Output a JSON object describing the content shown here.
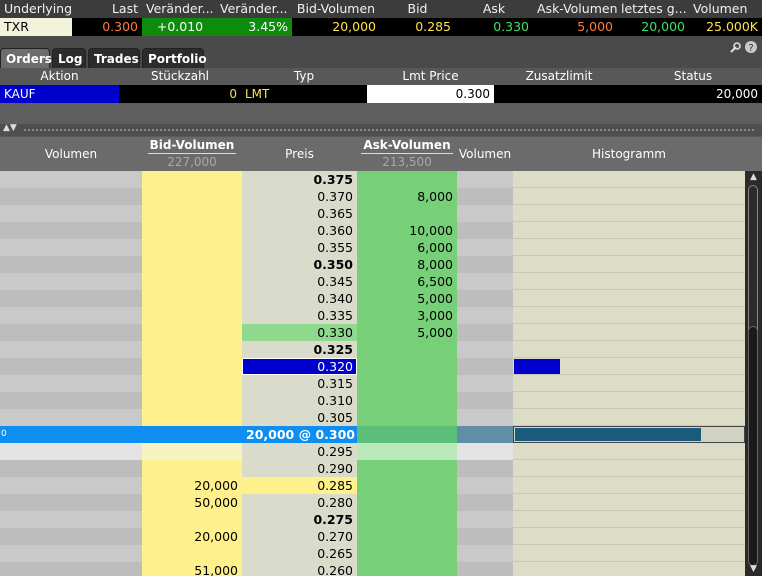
{
  "quote": {
    "headers": [
      "Underlying",
      "Last",
      "Veränder...",
      "Veränder...",
      "Bid-Volumen",
      "Bid",
      "Ask",
      "Ask-Volumen",
      "letztes g...",
      "Volumen"
    ],
    "symbol": "TXR",
    "last": "0.300",
    "change": "+0.010",
    "change_pct": "3.45%",
    "bid_volume": "20,000",
    "bid": "0.285",
    "ask": "0.330",
    "ask_volume": "5,000",
    "last_size": "20,000",
    "volume": "25.000K"
  },
  "tabs": [
    "Orders",
    "Log",
    "Trades",
    "Portfolio"
  ],
  "orders": {
    "headers": [
      "Aktion",
      "Stückzahl",
      "Typ",
      "Lmt Price",
      "Zusatzlimit",
      "Status"
    ],
    "row": {
      "action": "KAUF",
      "qty": "0",
      "type": "LMT",
      "lmt_price": "0.300",
      "zusatz": "",
      "status": "20,000"
    }
  },
  "ladder": {
    "headers": {
      "volumen_left": "Volumen",
      "bid_volumen": "Bid-Volumen",
      "bid_total": "227,000",
      "preis": "Preis",
      "ask_volumen": "Ask-Volumen",
      "ask_total": "213,500",
      "volumen_right": "Volumen",
      "histogramm": "Histogramm"
    },
    "rows": [
      {
        "price": "0.375",
        "bold": true,
        "bid": "",
        "ask": ""
      },
      {
        "price": "0.370",
        "bold": false,
        "bid": "",
        "ask": "8,000"
      },
      {
        "price": "0.365",
        "bold": false,
        "bid": "",
        "ask": ""
      },
      {
        "price": "0.360",
        "bold": false,
        "bid": "",
        "ask": "10,000"
      },
      {
        "price": "0.355",
        "bold": false,
        "bid": "",
        "ask": "6,000"
      },
      {
        "price": "0.350",
        "bold": true,
        "bid": "",
        "ask": "8,000"
      },
      {
        "price": "0.345",
        "bold": false,
        "bid": "",
        "ask": "6,500"
      },
      {
        "price": "0.340",
        "bold": false,
        "bid": "",
        "ask": "5,000"
      },
      {
        "price": "0.335",
        "bold": false,
        "bid": "",
        "ask": "3,000"
      },
      {
        "price": "0.330",
        "bold": false,
        "bid": "",
        "ask": "5,000",
        "best_ask": true
      },
      {
        "price": "0.325",
        "bold": true,
        "bid": "",
        "ask": ""
      },
      {
        "price": "0.320",
        "bold": false,
        "bid": "",
        "ask": "",
        "order": true
      },
      {
        "price": "0.315",
        "bold": false,
        "bid": "",
        "ask": ""
      },
      {
        "price": "0.310",
        "bold": false,
        "bid": "",
        "ask": ""
      },
      {
        "price": "0.305",
        "bold": false,
        "bid": "",
        "ask": ""
      },
      {
        "price": "20,000 @ 0.300",
        "bold": true,
        "bid": "",
        "ask": "",
        "last": true,
        "left_text": "0"
      },
      {
        "price": "0.295",
        "bold": false,
        "bid": "",
        "ask": "",
        "spread": true
      },
      {
        "price": "0.290",
        "bold": false,
        "bid": "",
        "ask": ""
      },
      {
        "price": "0.285",
        "bold": false,
        "bid": "20,000",
        "ask": "",
        "best_bid": true
      },
      {
        "price": "0.280",
        "bold": false,
        "bid": "50,000",
        "ask": ""
      },
      {
        "price": "0.275",
        "bold": true,
        "bid": "",
        "ask": ""
      },
      {
        "price": "0.270",
        "bold": false,
        "bid": "20,000",
        "ask": ""
      },
      {
        "price": "0.265",
        "bold": false,
        "bid": "",
        "ask": ""
      },
      {
        "price": "0.260",
        "bold": false,
        "bid": "51,000",
        "ask": ""
      }
    ],
    "histogram": {
      "order_fraction": 0.2,
      "last_fraction": 0.8
    }
  },
  "colors": {
    "bid": "#fef08a",
    "ask": "#77d077",
    "price": "#d9dccb",
    "order_blue": "#0000cc",
    "last_blue": "#0e8ef0"
  }
}
